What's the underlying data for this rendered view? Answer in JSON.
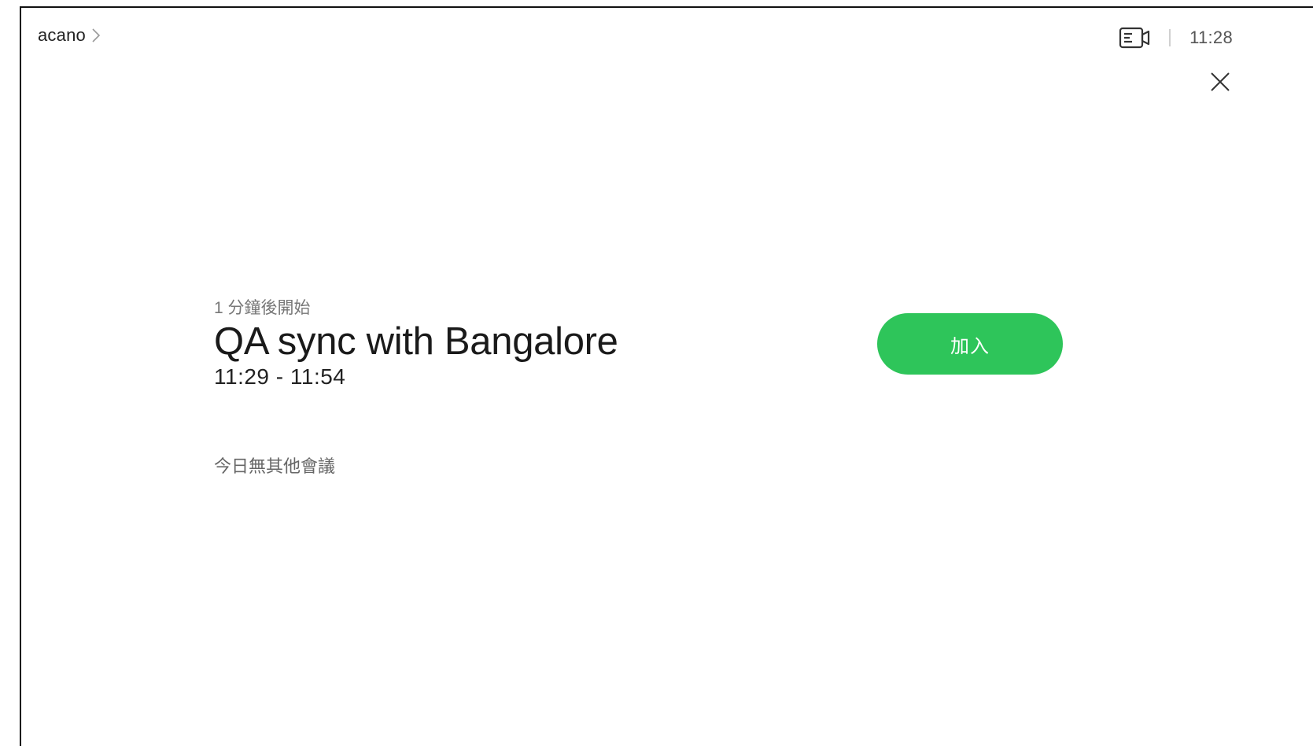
{
  "header": {
    "device_name": "acano",
    "clock": "11:28"
  },
  "icons": {
    "breadcrumb": "chevron-right-icon",
    "self_view": "video-camera-icon",
    "close": "close-icon"
  },
  "meeting": {
    "starts_in": "1 分鐘後開始",
    "title": "QA sync with Bangalore",
    "time_range": "11:29 - 11:54",
    "join_label": "加入"
  },
  "footer_note": "今日無其他會議",
  "colors": {
    "join_button": "#2ec55a"
  }
}
